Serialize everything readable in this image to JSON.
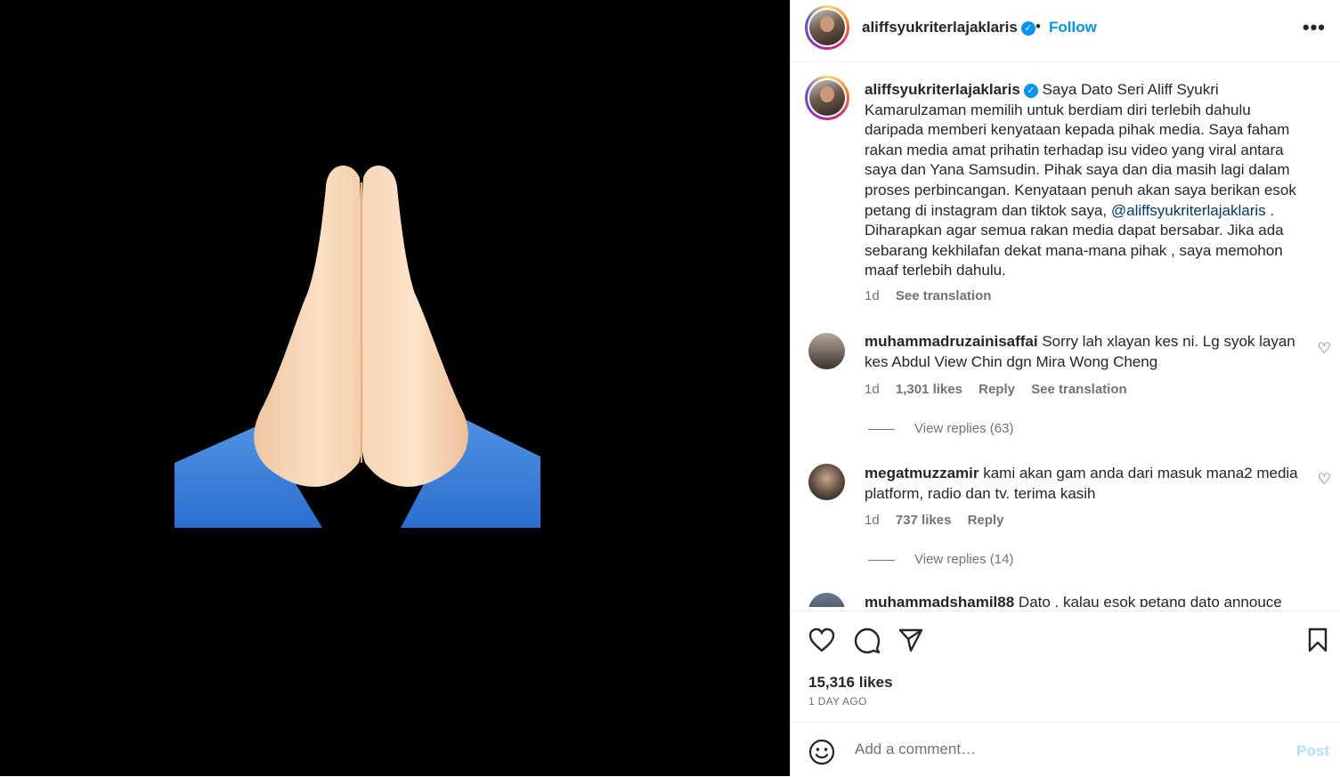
{
  "post": {
    "username": "aliffsyukriterlajaklaris",
    "verified_mark": "✓",
    "separator": "•",
    "follow_label": "Follow",
    "more_label": "•••",
    "media_icon": "folded-hands-emoji"
  },
  "caption": {
    "username": "aliffsyukriterlajaklaris",
    "text_before": "Saya Dato Seri Aliff Syukri Kamarulzaman memilih untuk berdiam diri terlebih dahulu daripada memberi kenyataan kepada pihak media. Saya faham rakan media amat prihatin terhadap isu video yang viral antara saya dan Yana Samsudin. Pihak saya dan dia masih lagi dalam proses perbincangan. Kenyataan penuh akan saya berikan esok petang di instagram dan tiktok saya, ",
    "mention": "@aliffsyukriterlajaklaris",
    "text_after": " . Diharapkan agar semua rakan media dapat bersabar. Jika ada sebarang kekhilafan dekat mana-mana pihak , saya memohon maaf terlebih dahulu.",
    "time": "1d",
    "see_translation": "See translation"
  },
  "comments": [
    {
      "username": "muhammadruzainisaffai",
      "text": "Sorry lah xlayan kes ni. Lg syok layan kes Abdul View Chin dgn Mira Wong Cheng",
      "time": "1d",
      "likes": "1,301 likes",
      "reply": "Reply",
      "see_translation": "See translation",
      "view_replies": "View replies (63)"
    },
    {
      "username": "megatmuzzamir",
      "text": "kami akan gam anda dari masuk mana2 media platform, radio dan tv. terima kasih",
      "time": "1d",
      "likes": "737 likes",
      "reply": "Reply",
      "view_replies": "View replies (14)"
    },
    {
      "username": "muhammadshamil88",
      "text": "Dato , kalau esok petang dato annouce"
    }
  ],
  "footer": {
    "likes": "15,316 likes",
    "time_ago": "1 DAY AGO",
    "comment_placeholder": "Add a comment…",
    "post_label": "Post"
  },
  "colors": {
    "accent": "#0095f6",
    "post_disabled": "#b2dffc",
    "secondary_text": "#737373",
    "sleeve": "#3b82d8",
    "skin": "#f3cfa8"
  }
}
